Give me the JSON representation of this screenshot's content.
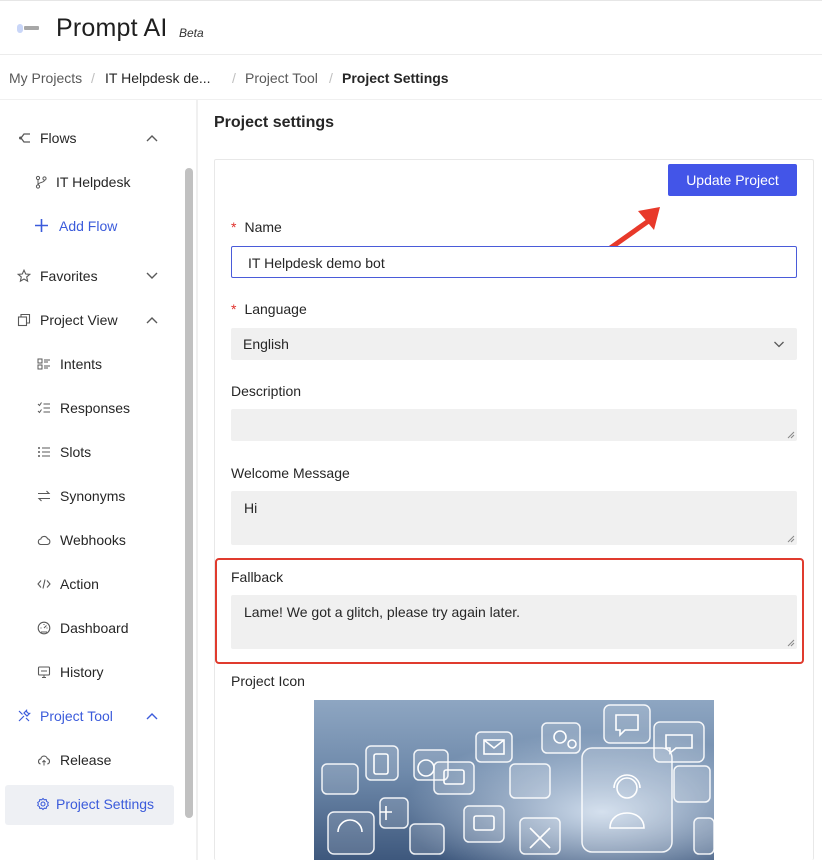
{
  "header": {
    "app_name": "Prompt AI",
    "badge": "Beta"
  },
  "breadcrumb": {
    "items": [
      "My Projects",
      "IT Helpdesk de...",
      "Project Tool",
      "Project Settings"
    ],
    "separator": "/"
  },
  "sidebar": {
    "flows": {
      "label": "Flows",
      "icon": "flow-icon",
      "expanded": true
    },
    "flow_items": [
      {
        "label": "IT Helpdesk",
        "icon": "branch-icon"
      }
    ],
    "add_flow": {
      "label": "Add Flow",
      "icon": "plus-icon"
    },
    "favorites": {
      "label": "Favorites",
      "icon": "star-icon",
      "expanded": false
    },
    "project_view": {
      "label": "Project View",
      "icon": "project-view-icon",
      "expanded": true
    },
    "project_view_items": [
      {
        "label": "Intents",
        "icon": "intents-icon"
      },
      {
        "label": "Responses",
        "icon": "responses-icon"
      },
      {
        "label": "Slots",
        "icon": "slots-icon"
      },
      {
        "label": "Synonyms",
        "icon": "synonyms-icon"
      },
      {
        "label": "Webhooks",
        "icon": "cloud-icon"
      },
      {
        "label": "Action",
        "icon": "code-icon"
      },
      {
        "label": "Dashboard",
        "icon": "dashboard-icon"
      },
      {
        "label": "History",
        "icon": "history-icon"
      }
    ],
    "project_tool": {
      "label": "Project Tool",
      "icon": "tools-icon",
      "expanded": true
    },
    "project_tool_items": [
      {
        "label": "Release",
        "icon": "release-icon"
      },
      {
        "label": "Project Settings",
        "icon": "settings-icon",
        "active": true
      }
    ]
  },
  "main": {
    "title": "Project settings",
    "update_button": "Update Project",
    "fields": {
      "name": {
        "label": "Name",
        "required": true,
        "value": "IT Helpdesk demo bot"
      },
      "language": {
        "label": "Language",
        "required": true,
        "value": "English"
      },
      "description": {
        "label": "Description",
        "value": ""
      },
      "welcome": {
        "label": "Welcome Message",
        "value": "Hi"
      },
      "fallback": {
        "label": "Fallback",
        "value": "Lame! We got a glitch, please try again later."
      },
      "icon": {
        "label": "Project Icon"
      }
    }
  },
  "colors": {
    "accent": "#4355e8",
    "highlight": "#e03b2e",
    "link": "#3b5bdb"
  }
}
